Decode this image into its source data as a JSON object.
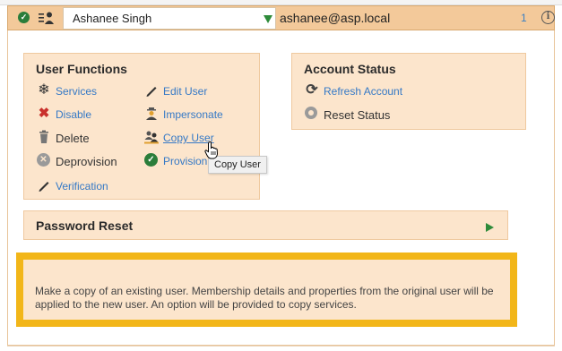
{
  "header": {
    "selected_user": "Ashanee Singh",
    "email": "ashanee@asp.local",
    "count": "1",
    "info_label": "i"
  },
  "user_functions": {
    "title": "User Functions",
    "items": [
      {
        "label": "Services",
        "icon": "snowflake-icon"
      },
      {
        "label": "Edit User",
        "icon": "pencil-icon"
      },
      {
        "label": "Disable",
        "icon": "x-mark-icon"
      },
      {
        "label": "Impersonate",
        "icon": "impersonate-icon"
      },
      {
        "label": "Delete",
        "icon": "trash-icon"
      },
      {
        "label": "Copy User",
        "icon": "copy-user-icon"
      },
      {
        "label": "Deprovision",
        "icon": "circle-x-icon"
      },
      {
        "label": "Provision",
        "icon": "check-circle-icon"
      },
      {
        "label": "Verification",
        "icon": "pencil-icon"
      }
    ]
  },
  "account_status": {
    "title": "Account Status",
    "items": [
      {
        "label": "Refresh Account",
        "icon": "refresh-icon"
      },
      {
        "label": "Reset Status",
        "icon": "radio-icon"
      }
    ]
  },
  "password_reset": {
    "title": "Password Reset"
  },
  "tooltip": "Copy User",
  "description": "Make a copy of an existing user. Membership details and properties from the original user will be applied to the new user. An option will be provided to copy services.",
  "colors": {
    "header_bg": "#f3c99a",
    "panel_bg": "#fce5cc",
    "link": "#3579c6",
    "highlight_border": "#f2b619",
    "green": "#2e8b3a"
  }
}
